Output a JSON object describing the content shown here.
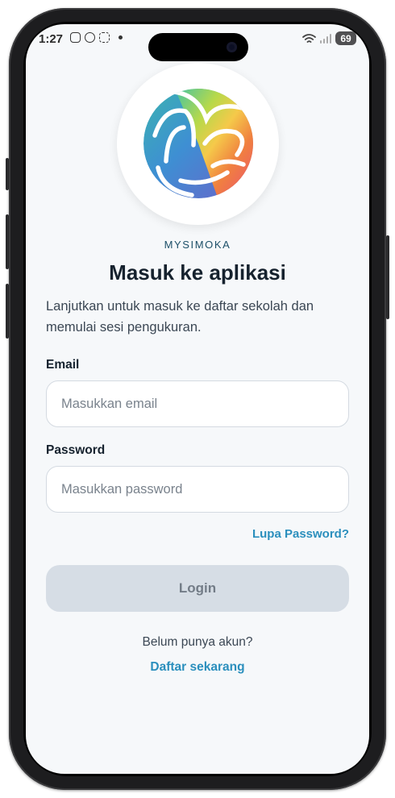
{
  "status_bar": {
    "time": "1:27",
    "battery": "69",
    "icons": [
      "instagram-icon",
      "whatsapp-icon",
      "screenshot-icon",
      "notification-dot-icon",
      "wifi-icon",
      "cellular-signal-icon",
      "battery-icon"
    ]
  },
  "app": {
    "brand": "MYSIMOKA",
    "title": "Masuk ke aplikasi",
    "subtitle": "Lanjutkan untuk masuk ke daftar sekolah dan memulai sesi pengukuran."
  },
  "form": {
    "email_label": "Email",
    "email_placeholder": "Masukkan email",
    "email_value": "",
    "password_label": "Password",
    "password_placeholder": "Masukkan password",
    "password_value": "",
    "forgot_label": "Lupa Password?",
    "login_label": "Login",
    "login_enabled": false
  },
  "footer": {
    "no_account": "Belum punya akun?",
    "register_label": "Daftar sekarang"
  },
  "colors": {
    "accent": "#2b8fbd",
    "brand_text": "#1c4f68",
    "title": "#16222e",
    "button_disabled_bg": "#d6dde5",
    "background": "#f6f8fa"
  }
}
